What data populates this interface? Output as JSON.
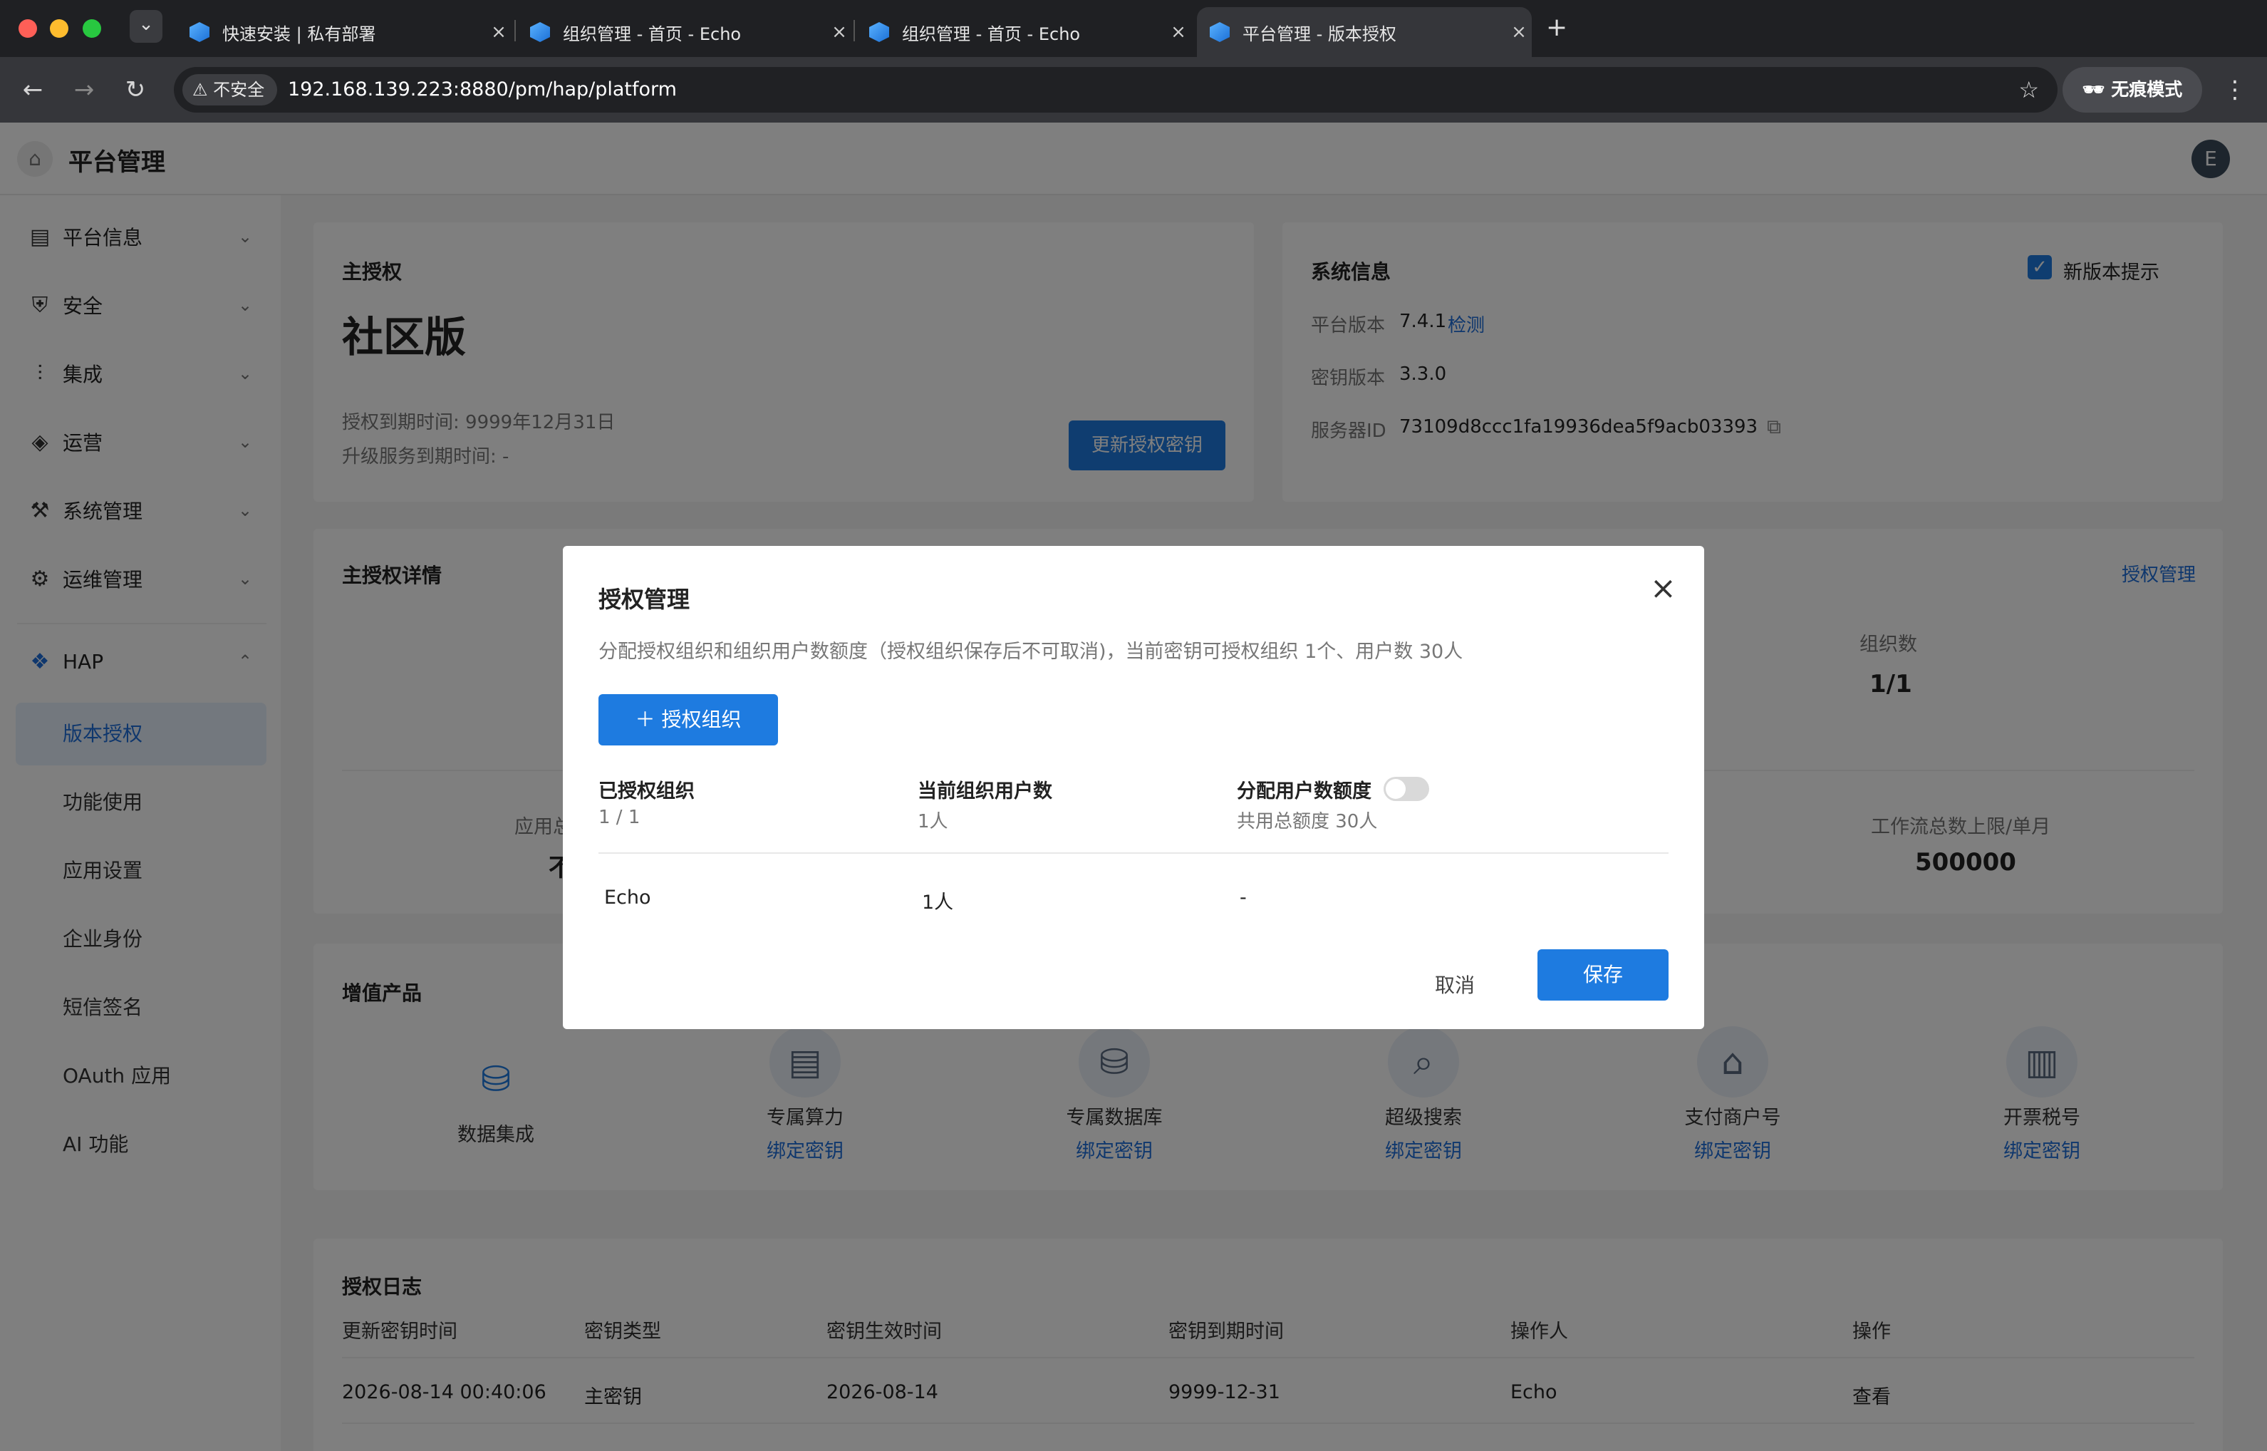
{
  "browser": {
    "tabs": [
      {
        "title": "快速安装 | 私有部署"
      },
      {
        "title": "组织管理 - 首页 - Echo"
      },
      {
        "title": "组织管理 - 首页 - Echo"
      },
      {
        "title": "平台管理 - 版本授权"
      }
    ],
    "new_tab": "+",
    "security_label": "不安全",
    "url": "192.168.139.223:8880/pm/hap/platform",
    "incognito_label": "无痕模式",
    "tab_dropdown": "⌄"
  },
  "app": {
    "title": "平台管理",
    "avatar_letter": "E"
  },
  "sidebar": {
    "groups": [
      {
        "label": "平台信息",
        "icon": "info-card-icon"
      },
      {
        "label": "安全",
        "icon": "shield-icon"
      },
      {
        "label": "集成",
        "icon": "integration-icon"
      },
      {
        "label": "运营",
        "icon": "layers-icon"
      },
      {
        "label": "系统管理",
        "icon": "tools-icon"
      },
      {
        "label": "运维管理",
        "icon": "user-gear-icon"
      },
      {
        "label": "HAP",
        "icon": "hap-logo-icon"
      }
    ],
    "sub_items": [
      "版本授权",
      "功能使用",
      "应用设置",
      "企业身份",
      "短信签名",
      "OAuth 应用",
      "AI 功能"
    ],
    "active_sub": "版本授权"
  },
  "license_card": {
    "label": "主授权",
    "edition": "社区版",
    "expire": "授权到期时间: 9999年12月31日",
    "upgrade_expire": "升级服务到期时间: -",
    "update_button": "更新授权密钥"
  },
  "system_card": {
    "label": "系统信息",
    "new_version_tip": "新版本提示",
    "platform_version_label": "平台版本",
    "platform_version": "7.4.1",
    "check_link": "检测",
    "key_version_label": "密钥版本",
    "key_version": "3.3.0",
    "server_id_label": "服务器ID",
    "server_id": "73109d8ccc1fa19936dea5f9acb03393"
  },
  "detail_card": {
    "label": "主授权详情",
    "manage_link": "授权管理",
    "org_count_label": "组织数",
    "org_count": "1/1",
    "app_total_label": "应用总",
    "app_total_value": "不",
    "workflow_label": "工作流总数上限/单月",
    "workflow_value": "500000"
  },
  "value_added": {
    "label": "增值产品",
    "products": [
      {
        "name": "数据集成",
        "bind": "",
        "icon": "database-sync-icon"
      },
      {
        "name": "专属算力",
        "bind": "绑定密钥",
        "icon": "server-icon"
      },
      {
        "name": "专属数据库",
        "bind": "绑定密钥",
        "icon": "database-icon"
      },
      {
        "name": "超级搜索",
        "bind": "绑定密钥",
        "icon": "search-icon"
      },
      {
        "name": "支付商户号",
        "bind": "绑定密钥",
        "icon": "store-icon"
      },
      {
        "name": "开票税号",
        "bind": "绑定密钥",
        "icon": "invoice-icon"
      }
    ]
  },
  "log": {
    "label": "授权日志",
    "columns": [
      "更新密钥时间",
      "密钥类型",
      "密钥生效时间",
      "密钥到期时间",
      "操作人",
      "操作"
    ],
    "rows": [
      [
        "2026-08-14 00:40:06",
        "主密钥",
        "2026-08-14",
        "9999-12-31",
        "Echo",
        "查看"
      ]
    ]
  },
  "dialog": {
    "title": "授权管理",
    "description": "分配授权组织和组织用户数额度（授权组织保存后不可取消)，当前密钥可授权组织 1个、用户数 30人",
    "add_button": "授权组织",
    "col1_title": "已授权组织",
    "col1_sub": "1 / 1",
    "col2_title": "当前组织用户数",
    "col2_sub": "1人",
    "col3_title": "分配用户数额度",
    "col3_sub": "共用总额度 30人",
    "toggle_on": false,
    "rows": [
      [
        "Echo",
        "1人",
        "-"
      ]
    ],
    "cancel": "取消",
    "save": "保存"
  },
  "colors": {
    "primary": "#1e7be0",
    "link": "#1e6fdb",
    "active_bg": "#e6f0fd"
  }
}
